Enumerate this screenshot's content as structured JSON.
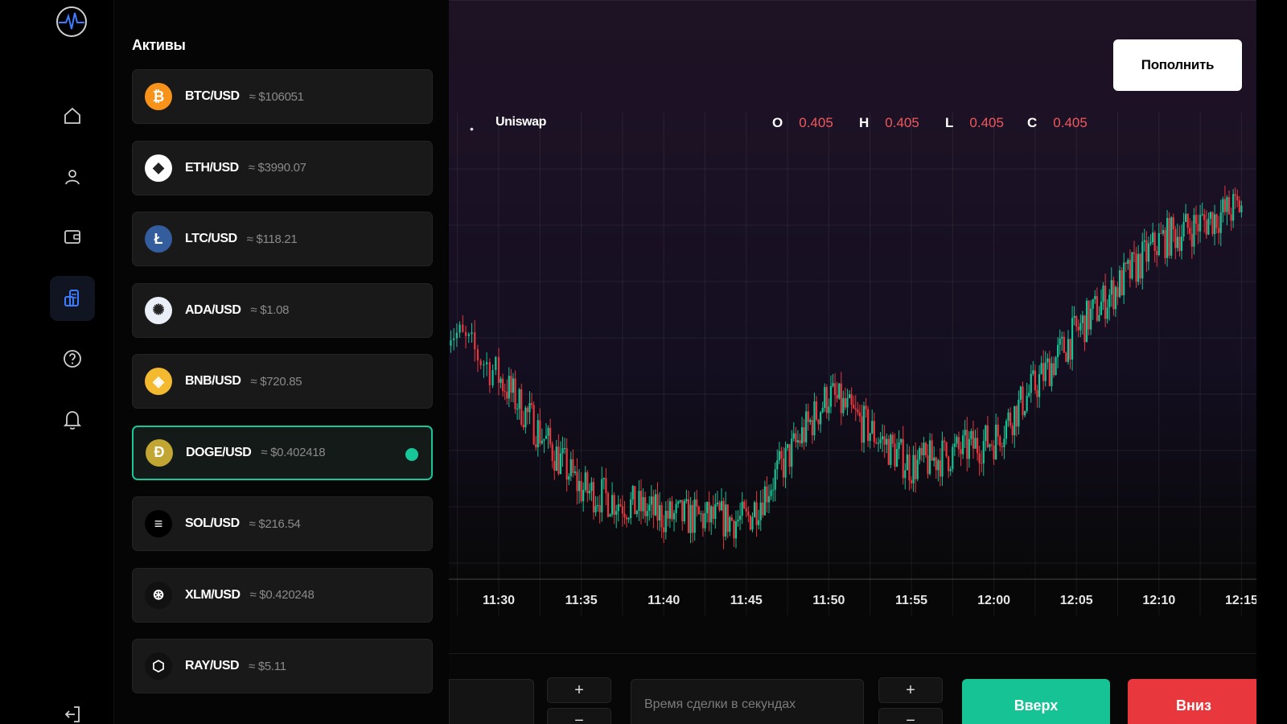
{
  "rail": {
    "items": [
      "home-icon",
      "user-icon",
      "wallet-icon",
      "assets-icon",
      "help-icon",
      "bell-icon",
      "logout-icon"
    ],
    "active": "assets-icon"
  },
  "assets": {
    "title": "Активы",
    "items": [
      {
        "pair": "BTC/USD",
        "price": "≈ $106051",
        "icon": "bitcoin-icon",
        "color": "#f7931a",
        "glyph": "₿"
      },
      {
        "pair": "ETH/USD",
        "price": "≈ $3990.07",
        "icon": "ethereum-icon",
        "color": "#ffffff",
        "glyph": "◆"
      },
      {
        "pair": "LTC/USD",
        "price": "≈ $118.21",
        "icon": "litecoin-icon",
        "color": "#345d9d",
        "glyph": "Ł"
      },
      {
        "pair": "ADA/USD",
        "price": "≈ $1.08",
        "icon": "cardano-icon",
        "color": "#e9eef7",
        "glyph": "✺"
      },
      {
        "pair": "BNB/USD",
        "price": "≈ $720.85",
        "icon": "bnb-icon",
        "color": "#f3ba2f",
        "glyph": "◈"
      },
      {
        "pair": "DOGE/USD",
        "price": "≈ $0.402418",
        "icon": "dogecoin-icon",
        "color": "#c2a633",
        "glyph": "Ð",
        "selected": true
      },
      {
        "pair": "SOL/USD",
        "price": "≈ $216.54",
        "icon": "solana-icon",
        "color": "#000000",
        "glyph": "≡"
      },
      {
        "pair": "XLM/USD",
        "price": "≈ $0.420248",
        "icon": "stellar-icon",
        "color": "#111111",
        "glyph": "⊛"
      },
      {
        "pair": "RAY/USD",
        "price": "≈ $5.11",
        "icon": "raydium-icon",
        "color": "#111111",
        "glyph": "⬡"
      }
    ]
  },
  "header": {
    "deposit_label": "Пополнить"
  },
  "chart": {
    "asset_name": "Uniswap",
    "ohlc": {
      "o_label": "O",
      "o": "0.405",
      "h_label": "H",
      "h": "0.405",
      "l_label": "L",
      "l": "0.405",
      "c_label": "C",
      "c": "0.405"
    }
  },
  "chart_data": {
    "type": "line",
    "title": "",
    "x": [
      "11:30",
      "11:35",
      "11:40",
      "11:45",
      "11:50",
      "11:55",
      "12:00",
      "12:05",
      "12:10",
      "12:15"
    ],
    "series": [
      {
        "values": [
          0.4045,
          0.402,
          0.4014,
          0.4013,
          0.4041,
          0.4025,
          0.4031,
          0.4055,
          0.4075,
          0.4083
        ]
      }
    ],
    "up_color": "#16c394",
    "down_color": "#e8383d",
    "grid": true
  },
  "controls": {
    "plus": "+",
    "minus": "−",
    "time_placeholder": "Время сделки в секундах",
    "up_label": "Вверх",
    "down_label": "Вниз"
  }
}
